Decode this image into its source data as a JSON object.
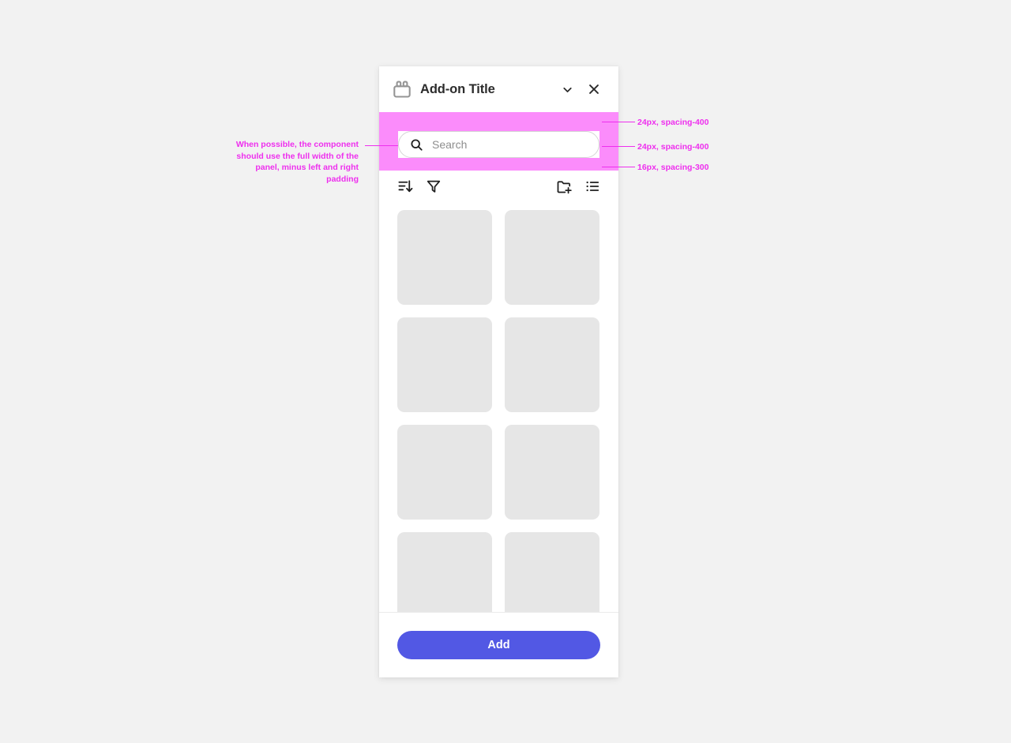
{
  "canvas": {
    "background_color": "#f2f2f2"
  },
  "panel": {
    "header": {
      "title": "Add-on Title",
      "addon_icon": "addon-plugin-icon",
      "collapse_icon": "chevron-down-icon",
      "close_icon": "close-icon"
    },
    "search": {
      "placeholder": "Search",
      "value": "",
      "icon": "search-icon"
    },
    "toolbar": {
      "left": [
        {
          "icon": "sort-icon",
          "label": "Sort"
        },
        {
          "icon": "filter-icon",
          "label": "Filter"
        }
      ],
      "right": [
        {
          "icon": "new-folder-icon",
          "label": "New folder"
        },
        {
          "icon": "list-view-icon",
          "label": "List view"
        }
      ]
    },
    "grid": {
      "columns": 2,
      "card_count": 8,
      "card_color": "#e6e6e6"
    },
    "footer": {
      "primary_button": "Add",
      "primary_button_color": "#5258e4"
    }
  },
  "annotations": {
    "accent_color": "#ee2fee",
    "highlight_color": "#fb8cfb",
    "left_note": "When possible, the component\nshould use the full width of the\npanel, minus left and right padding",
    "right_notes": [
      "24px, spacing-400",
      "24px, spacing-400",
      "16px, spacing-300"
    ]
  }
}
